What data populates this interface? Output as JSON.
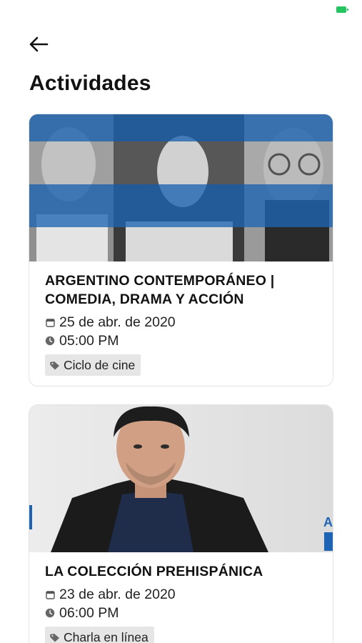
{
  "header": {
    "title": "Actividades"
  },
  "colors": {
    "accent_blue": "#1e64b4",
    "battery": "#22c55e",
    "tag_bg": "#e6e6e6"
  },
  "icons": {
    "back": "arrow-left-icon",
    "date": "calendar-icon",
    "time": "clock-icon",
    "tag": "tag-icon"
  },
  "activities": [
    {
      "title": "ARGENTINO CONTEMPORÁNEO | COMEDIA, DRAMA Y ACCIÓN",
      "date": "25 de abr. de 2020",
      "time": "05:00 PM",
      "category": "Ciclo de cine"
    },
    {
      "title": "LA COLECCIÓN PREHISPÁNICA",
      "date": "23 de abr. de 2020",
      "time": "06:00 PM",
      "category": "Charla en línea"
    }
  ]
}
